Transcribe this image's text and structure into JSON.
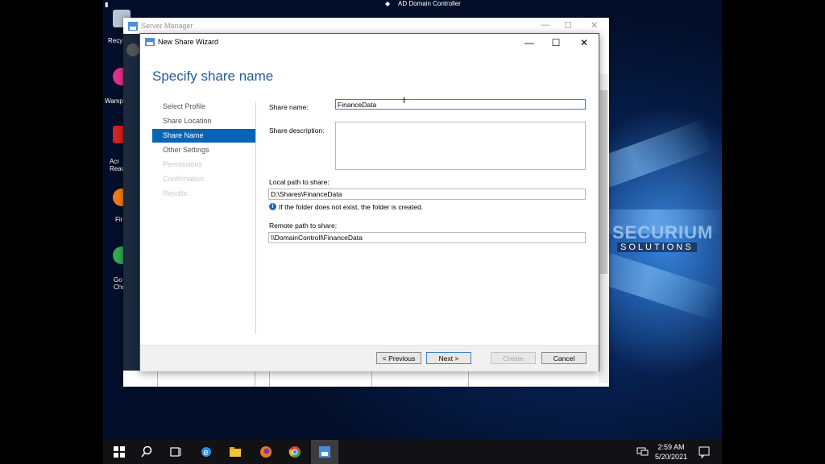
{
  "session_title": "AD Domain Controller",
  "desktop_icons": [
    {
      "label": "Recy",
      "color": "#b8c4d0"
    },
    {
      "label": "Wamp",
      "color": "#e0308a"
    },
    {
      "label": "Acr Reac",
      "color": "#d2231e"
    },
    {
      "label": "Fir",
      "color": "#f07a1a"
    },
    {
      "label": "Go Chr",
      "color": "#34a853"
    }
  ],
  "server_manager": {
    "title": "Server Manager",
    "controls": [
      "—",
      "☐",
      "✕"
    ]
  },
  "wizard": {
    "title": "New Share Wizard",
    "heading": "Specify share name",
    "nav": [
      {
        "label": "Select Profile",
        "state": "normal"
      },
      {
        "label": "Share Location",
        "state": "normal"
      },
      {
        "label": "Share Name",
        "state": "active"
      },
      {
        "label": "Other Settings",
        "state": "normal"
      },
      {
        "label": "Permissions",
        "state": "disabled"
      },
      {
        "label": "Confirmation",
        "state": "disabled"
      },
      {
        "label": "Results",
        "state": "disabled"
      }
    ],
    "share_name_label": "Share name:",
    "share_name_value": "FinanceData",
    "share_description_label": "Share description:",
    "share_description_value": "",
    "local_path_label": "Local path to share:",
    "local_path_value": "D:\\Shares\\FinanceData",
    "info_text": "If the folder does not exist, the folder is created.",
    "remote_path_label": "Remote path to share:",
    "remote_path_value": "\\\\DomainControll\\FinanceData",
    "buttons": {
      "previous": "< Previous",
      "next": "Next >",
      "create": "Create",
      "cancel": "Cancel"
    }
  },
  "watermark": {
    "line1": "SECURIUM",
    "line2": "SOLUTIONS"
  },
  "taskbar": {
    "time": "2:59 AM",
    "date": "5/20/2021",
    "pinned": [
      "start-icon",
      "search-icon",
      "task-view-icon",
      "internet-explorer-icon",
      "file-explorer-icon",
      "firefox-icon",
      "chrome-icon",
      "server-manager-icon"
    ]
  }
}
